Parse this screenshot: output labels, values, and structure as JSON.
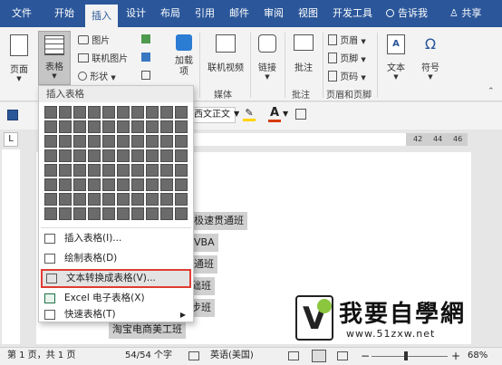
{
  "tabs": [
    {
      "label": "文件",
      "active": false
    },
    {
      "label": "开始",
      "active": false
    },
    {
      "label": "插入",
      "active": true
    },
    {
      "label": "设计",
      "active": false
    },
    {
      "label": "布局",
      "active": false
    },
    {
      "label": "引用",
      "active": false
    },
    {
      "label": "邮件",
      "active": false
    },
    {
      "label": "审阅",
      "active": false
    },
    {
      "label": "视图",
      "active": false
    },
    {
      "label": "开发工具",
      "active": false
    }
  ],
  "tell_me": "告诉我",
  "share": "共享",
  "ribbon": {
    "page": "页面",
    "table": "表格",
    "picture": "图片",
    "online_picture": "联机图片",
    "shapes": "形状",
    "addin": "加载项",
    "online_video": "联机视频",
    "link": "链接",
    "comment": "批注",
    "header": "页眉",
    "footer": "页脚",
    "page_number": "页码",
    "text": "文本",
    "symbol": "符号"
  },
  "groups": {
    "media": "媒体",
    "comments": "批注",
    "header_footer": "页眉和页脚"
  },
  "qat": {
    "font_name": "西文正文",
    "font_color_letter": "A"
  },
  "ruler_highlight": [
    "42",
    "44",
    "46"
  ],
  "menu": {
    "title": "插入表格",
    "items": [
      {
        "label": "插入表格(I)...",
        "icon": "table-icon"
      },
      {
        "label": "绘制表格(D)",
        "icon": "draw-table-icon"
      },
      {
        "label": "文本转换成表格(V)...",
        "icon": "text-to-table-icon",
        "highlighted": true
      },
      {
        "label": "Excel 电子表格(X)",
        "icon": "excel-icon"
      },
      {
        "label": "快速表格(T)",
        "icon": "quick-table-icon"
      }
    ]
  },
  "doc_lines": [
    "极速贯通班",
    "VBA",
    "通班",
    "基础班",
    "起步班",
    "淘宝电商美工班"
  ],
  "watermark": {
    "text": "我要自學網",
    "url": "www.51zxw.net"
  },
  "status": {
    "page": "第 1 页，共 1 页",
    "words": "54/54 个字",
    "language": "英语(美国)",
    "zoom": "68%"
  },
  "colors": {
    "accent": "#2b579a",
    "highlight_border": "#e03c31",
    "font_color": "#d83b01"
  }
}
